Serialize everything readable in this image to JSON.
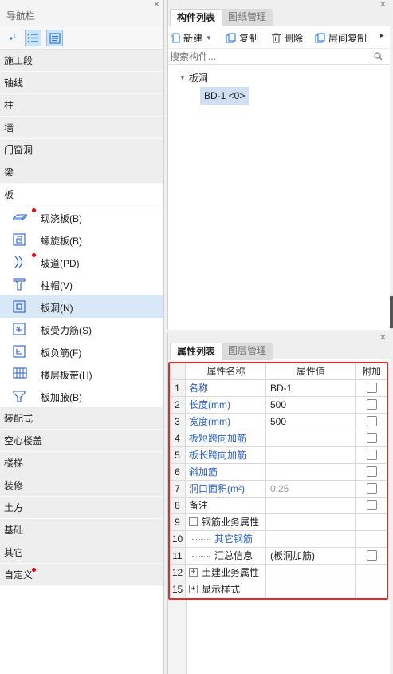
{
  "nav": {
    "title": "导航栏",
    "categories_top": [
      "施工段",
      "轴线",
      "柱",
      "墙",
      "门窗洞",
      "梁",
      "板"
    ],
    "board_items": [
      {
        "label": "现浇板(B)",
        "icon": "slab-icon",
        "dot": true
      },
      {
        "label": "螺旋板(B)",
        "icon": "spiral-slab-icon",
        "dot": false
      },
      {
        "label": "坡道(PD)",
        "icon": "ramp-icon",
        "dot": true
      },
      {
        "label": "柱帽(V)",
        "icon": "column-cap-icon",
        "dot": false
      },
      {
        "label": "板洞(N)",
        "icon": "slab-hole-icon",
        "dot": false
      },
      {
        "label": "板受力筋(S)",
        "icon": "slab-rebar-icon",
        "dot": false
      },
      {
        "label": "板负筋(F)",
        "icon": "negative-rebar-icon",
        "dot": false
      },
      {
        "label": "楼层板带(H)",
        "icon": "floor-strip-icon",
        "dot": false
      },
      {
        "label": "板加腋(B)",
        "icon": "slab-haunch-icon",
        "dot": false
      }
    ],
    "categories_bottom": [
      "装配式",
      "空心楼盖",
      "楼梯",
      "装修",
      "土方",
      "基础",
      "其它",
      "自定义"
    ]
  },
  "components": {
    "tabs": [
      "构件列表",
      "图纸管理"
    ],
    "toolbar": {
      "new": "新建",
      "copy": "复制",
      "delete": "删除",
      "floor_copy": "层间复制"
    },
    "search_placeholder": "搜索构件...",
    "tree_root": "板洞",
    "tree_leaf": "BD-1 <0>"
  },
  "properties": {
    "tabs": [
      "属性列表",
      "图层管理"
    ],
    "headers": {
      "name": "属性名称",
      "value": "属性值",
      "extra": "附加"
    },
    "rows": [
      {
        "num": "1",
        "name": "名称",
        "value": "BD-1"
      },
      {
        "num": "2",
        "name": "长度(mm)",
        "value": "500"
      },
      {
        "num": "3",
        "name": "宽度(mm)",
        "value": "500"
      },
      {
        "num": "4",
        "name": "板短跨向加筋",
        "value": ""
      },
      {
        "num": "5",
        "name": "板长跨向加筋",
        "value": ""
      },
      {
        "num": "6",
        "name": "斜加筋",
        "value": ""
      },
      {
        "num": "7",
        "name": "洞口面积(m²)",
        "value": "0.25"
      },
      {
        "num": "8",
        "name": "备注",
        "value": ""
      },
      {
        "num": "9",
        "name": "钢筋业务属性",
        "value": ""
      },
      {
        "num": "10",
        "name": "其它钢筋",
        "value": ""
      },
      {
        "num": "11",
        "name": "汇总信息",
        "value": "(板洞加筋)"
      },
      {
        "num": "12",
        "name": "土建业务属性",
        "value": ""
      },
      {
        "num": "15",
        "name": "显示样式",
        "value": ""
      }
    ]
  }
}
